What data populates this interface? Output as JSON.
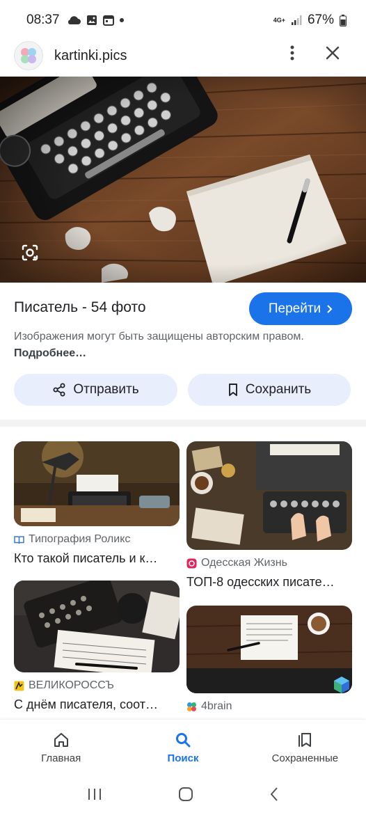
{
  "status_bar": {
    "time": "08:37",
    "network": "4G+",
    "battery": "67%"
  },
  "site": {
    "name": "kartinki.pics"
  },
  "result": {
    "title": "Писатель - 54 фото",
    "go_label": "Перейти",
    "note_text": "Изображения могут быть защищены авторским правом.",
    "note_more": "Подробнее…"
  },
  "actions": {
    "share_label": "Отправить",
    "save_label": "Сохранить"
  },
  "related": [
    {
      "source": "Типография Роликс",
      "caption": "Кто такой писатель и к…"
    },
    {
      "source": "Одесская Жизнь",
      "caption": "ТОП-8 одесских писате…"
    },
    {
      "source": "ВЕЛИКОРОССЪ",
      "caption": "С днём писателя, соот…"
    },
    {
      "source": "4brain",
      "caption": ""
    }
  ],
  "bottom_nav": [
    {
      "label": "Главная",
      "icon": "home-icon"
    },
    {
      "label": "Поиск",
      "icon": "search-icon"
    },
    {
      "label": "Сохраненные",
      "icon": "saved-icon"
    }
  ],
  "colors": {
    "accent": "#1a73e8",
    "chip_bg": "#e8eefb",
    "text": "#202124",
    "muted": "#5f6368"
  }
}
